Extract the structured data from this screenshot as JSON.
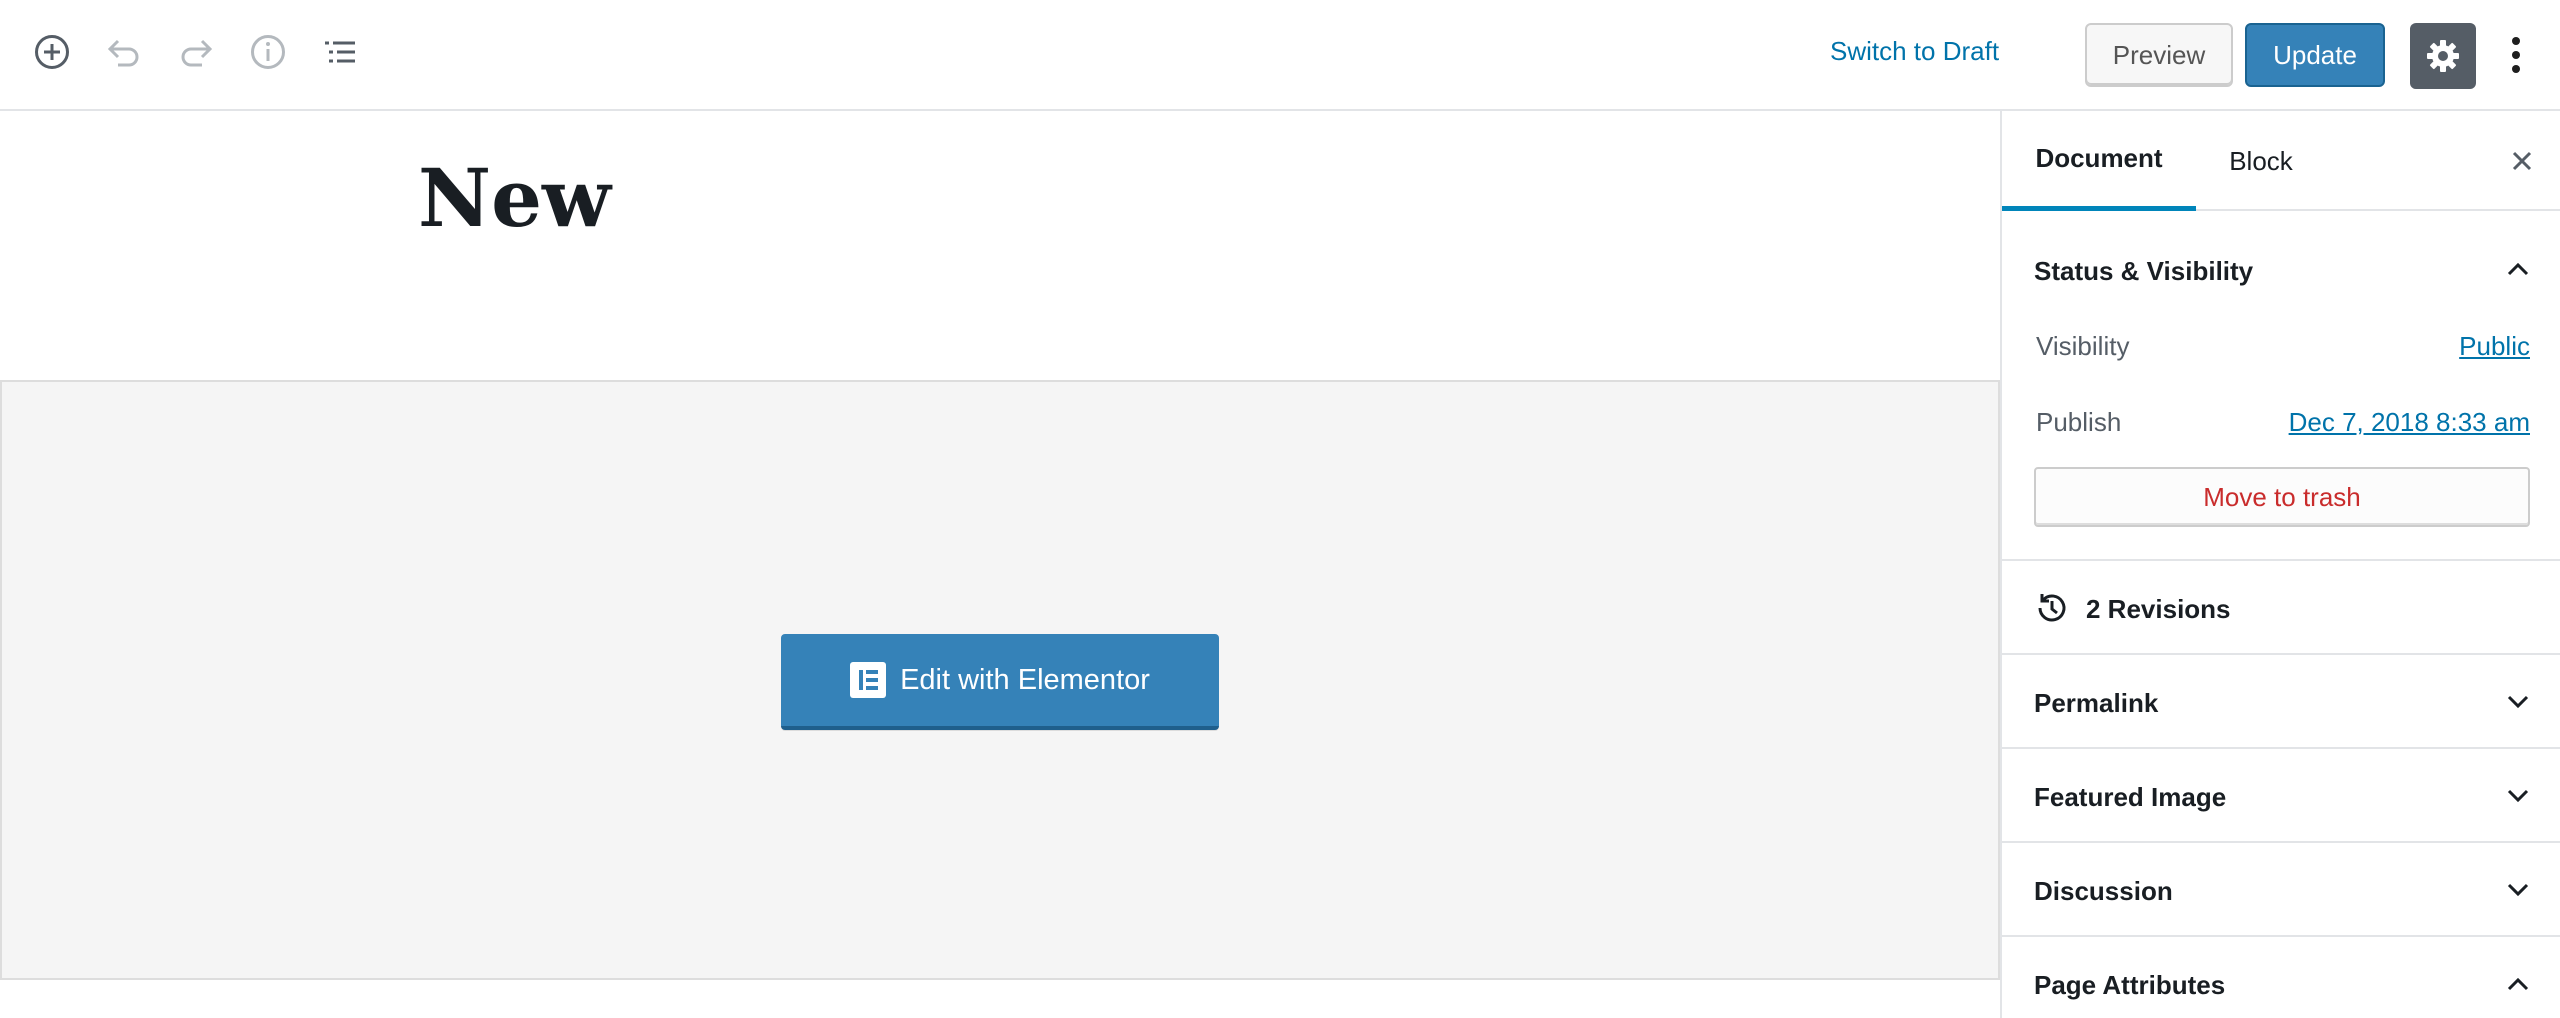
{
  "toolbar": {
    "icons": [
      "add-block-icon",
      "undo-icon",
      "redo-icon",
      "info-icon",
      "outline-icon",
      "gear-icon",
      "more-vertical-icon"
    ],
    "switch_to_draft": "Switch to Draft",
    "preview": "Preview",
    "update": "Update"
  },
  "editor": {
    "title": "New",
    "elementor_button": "Edit with Elementor"
  },
  "sidebar": {
    "tabs": {
      "document": "Document",
      "block": "Block"
    },
    "status_visibility": {
      "title": "Status & Visibility",
      "visibility_label": "Visibility",
      "visibility_value": "Public",
      "publish_label": "Publish",
      "publish_value": "Dec 7, 2018 8:33 am",
      "trash": "Move to trash"
    },
    "revisions": "2 Revisions",
    "permalink": "Permalink",
    "featured_image": "Featured Image",
    "discussion": "Discussion",
    "page_attributes": "Page Attributes"
  },
  "colors": {
    "accent": "#0073aa",
    "button_primary": "#3582b8",
    "danger": "#c92c2c",
    "settings_bg": "#555d66"
  }
}
